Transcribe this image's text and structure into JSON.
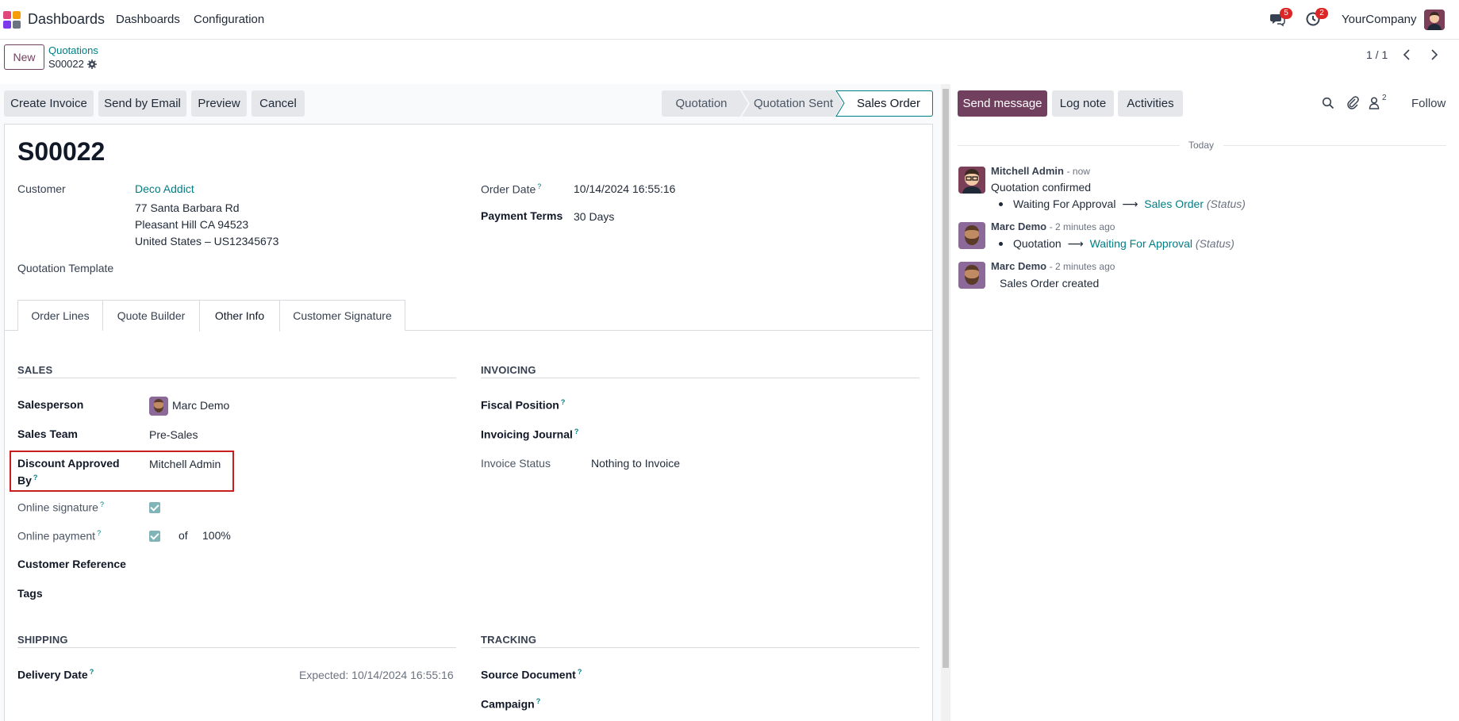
{
  "nav": {
    "app_name": "Dashboards",
    "menu": [
      "Dashboards",
      "Configuration"
    ],
    "messages_count": "5",
    "activities_count": "2",
    "company": "YourCompany"
  },
  "control": {
    "new_label": "New",
    "breadcrumb_parent": "Quotations",
    "breadcrumb_current": "S00022",
    "pager": "1 / 1"
  },
  "actions": [
    "Create Invoice",
    "Send by Email",
    "Preview",
    "Cancel"
  ],
  "stages": [
    {
      "label": "Quotation",
      "active": false
    },
    {
      "label": "Quotation Sent",
      "active": false
    },
    {
      "label": "Sales Order",
      "active": true
    }
  ],
  "record": {
    "title": "S00022",
    "customer_label": "Customer",
    "customer_name": "Deco Addict",
    "address_lines": [
      "77 Santa Barbara Rd",
      "Pleasant Hill CA 94523",
      "United States – US12345673"
    ],
    "order_date_label": "Order Date",
    "order_date": "10/14/2024 16:55:16",
    "payment_terms_label": "Payment Terms",
    "payment_terms": "30 Days",
    "template_label": "Quotation Template"
  },
  "tabs": [
    {
      "label": "Order Lines",
      "active": false
    },
    {
      "label": "Quote Builder",
      "active": false
    },
    {
      "label": "Other Info",
      "active": true
    },
    {
      "label": "Customer Signature",
      "active": false
    }
  ],
  "sales": {
    "title": "SALES",
    "salesperson_label": "Salesperson",
    "salesperson": "Marc Demo",
    "team_label": "Sales Team",
    "team": "Pre-Sales",
    "discount_label_1": "Discount Approved",
    "discount_label_2": "By",
    "discount_by": "Mitchell Admin",
    "online_signature_label": "Online signature",
    "online_signature": true,
    "online_payment_label": "Online payment",
    "online_payment": true,
    "of_label": "of",
    "payment_percent": "100%",
    "customer_ref_label": "Customer Reference",
    "tags_label": "Tags"
  },
  "invoicing": {
    "title": "INVOICING",
    "fiscal_label": "Fiscal Position",
    "journal_label": "Invoicing Journal",
    "status_label": "Invoice Status",
    "status": "Nothing to Invoice"
  },
  "shipping": {
    "title": "SHIPPING",
    "delivery_label": "Delivery Date",
    "expected": "Expected: 10/14/2024 16:55:16"
  },
  "tracking": {
    "title": "TRACKING",
    "source_label": "Source Document",
    "campaign_label": "Campaign"
  },
  "chatter": {
    "send_message": "Send message",
    "log_note": "Log note",
    "activities": "Activities",
    "followers_count": "2",
    "follow": "Follow",
    "today": "Today",
    "messages": [
      {
        "author": "Mitchell Admin",
        "when": "- now",
        "body": "Quotation confirmed",
        "from": "Waiting For Approval",
        "to": "Sales Order",
        "tag": "(Status)"
      },
      {
        "author": "Marc Demo",
        "when": "- 2 minutes ago",
        "from": "Quotation",
        "to": "Waiting For Approval",
        "tag": "(Status)"
      },
      {
        "author": "Marc Demo",
        "when": "- 2 minutes ago",
        "body": "Sales Order created"
      }
    ]
  },
  "colors": {
    "brand": "#71405e",
    "link": "#017e84",
    "highlight": "#c81e1e"
  }
}
